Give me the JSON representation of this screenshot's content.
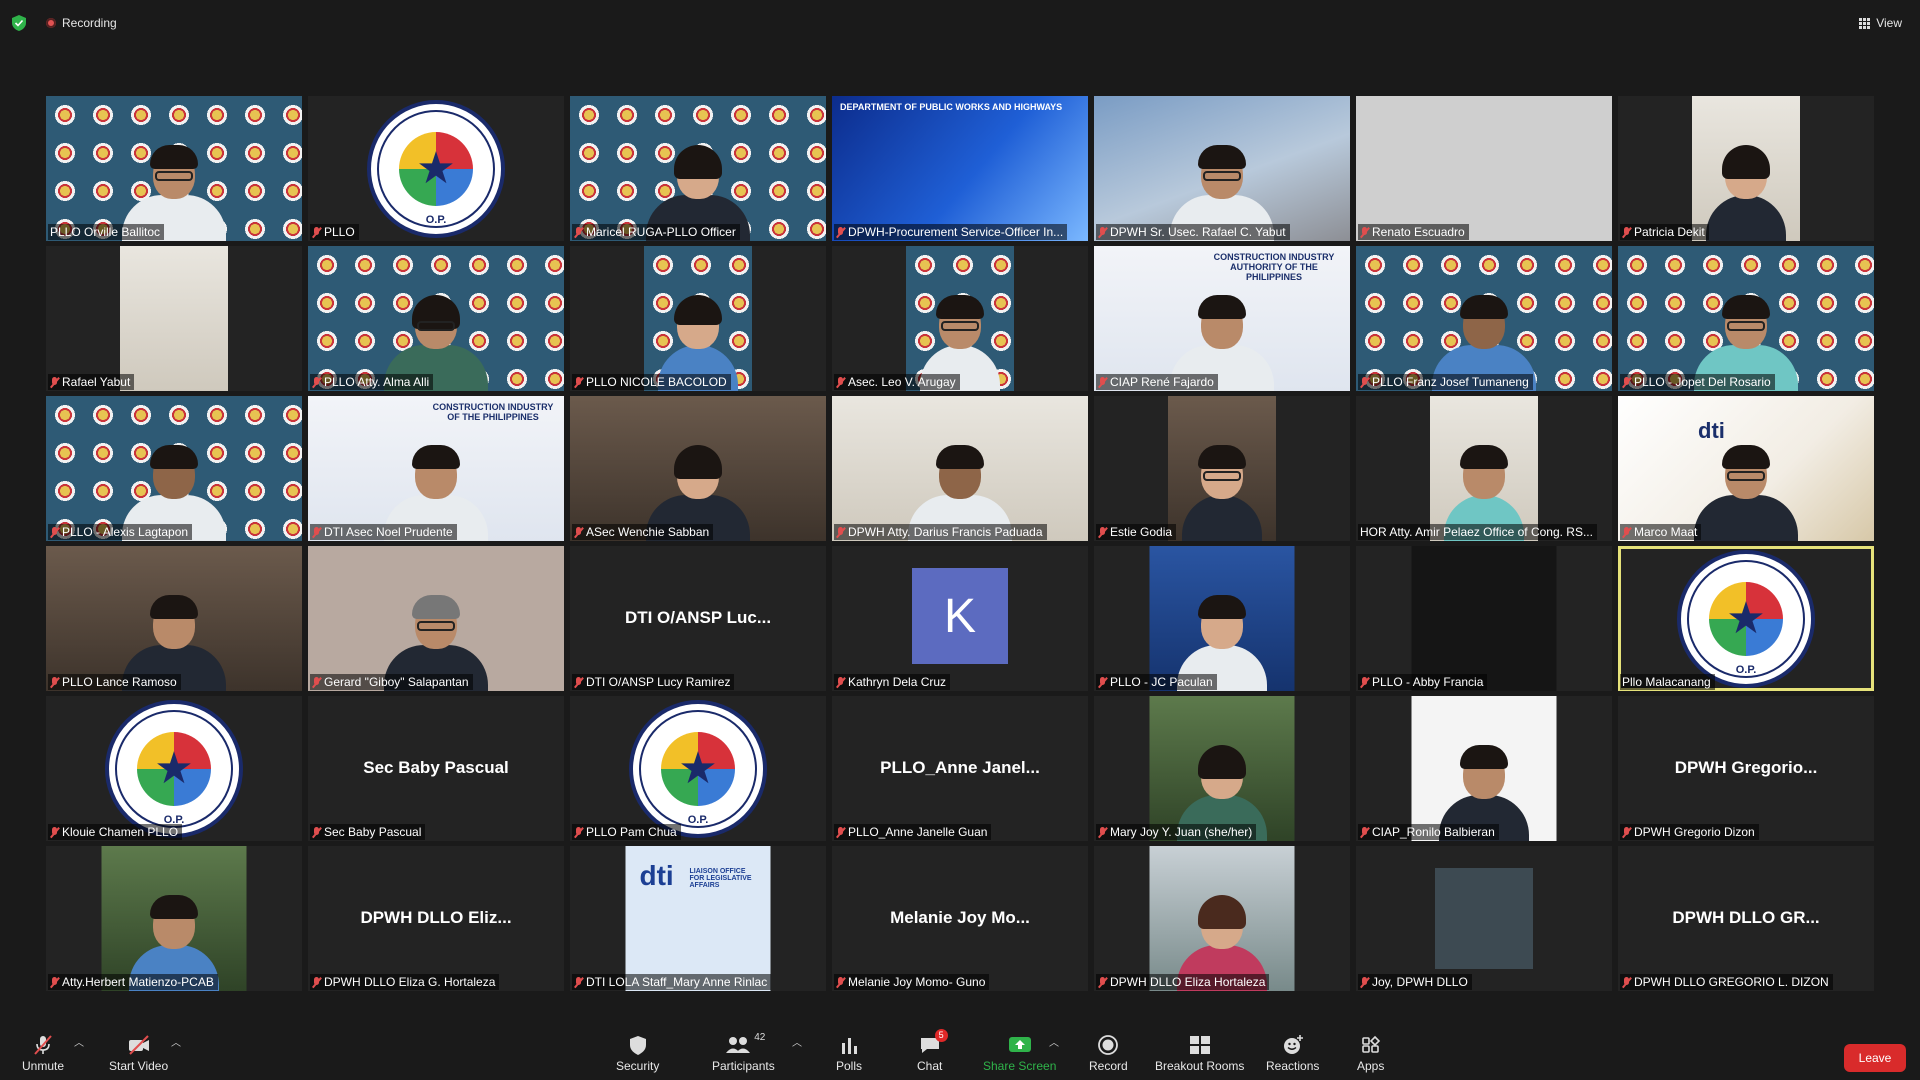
{
  "topbar": {
    "recording_label": "Recording",
    "view_label": "View"
  },
  "participants": [
    {
      "name": "PLLO Orville Ballitoc",
      "muted": false
    },
    {
      "name": "PLLO",
      "muted": true
    },
    {
      "name": "Maricel RUGA-PLLO Officer",
      "muted": true
    },
    {
      "name": "DPWH-Procurement Service-Officer In...",
      "muted": true,
      "banner": "DEPARTMENT OF PUBLIC WORKS AND HIGHWAYS"
    },
    {
      "name": "DPWH Sr. Usec. Rafael C. Yabut",
      "muted": true
    },
    {
      "name": "Renato Escuadro",
      "muted": true
    },
    {
      "name": "Patricia Dekit",
      "muted": true
    },
    {
      "name": "Rafael Yabut",
      "muted": true
    },
    {
      "name": "PLLO Atty. Alma Alli",
      "muted": true
    },
    {
      "name": "PLLO NICOLE BACOLOD",
      "muted": true
    },
    {
      "name": "Asec. Leo V. Arugay",
      "muted": true
    },
    {
      "name": "CIAP René Fajardo",
      "muted": true,
      "banner": "CONSTRUCTION INDUSTRY AUTHORITY OF THE PHILIPPINES"
    },
    {
      "name": "PLLO Franz Josef Tumaneng",
      "muted": true
    },
    {
      "name": "PLLO - Jopet Del Rosario",
      "muted": true
    },
    {
      "name": "PLLO - Alexis Lagtapon",
      "muted": true
    },
    {
      "name": "DTI Asec Noel Prudente",
      "muted": true,
      "banner": "CONSTRUCTION INDUSTRY OF THE PHILIPPINES"
    },
    {
      "name": "ASec Wenchie Sabban",
      "muted": true
    },
    {
      "name": "DPWH Atty. Darius Francis Paduada",
      "muted": true
    },
    {
      "name": "Estie Godia",
      "muted": true
    },
    {
      "name": "HOR Atty. Amir Pelaez Office of Cong. RS...",
      "muted": false
    },
    {
      "name": "Marco Maat",
      "muted": true
    },
    {
      "name": "PLLO Lance Ramoso",
      "muted": true
    },
    {
      "name": "Gerard \"Giboy\" Salapantan",
      "muted": true
    },
    {
      "name": "DTI O/ANSP Lucy Ramirez",
      "muted": true,
      "display": "DTI O/ANSP Luc..."
    },
    {
      "name": "Kathryn Dela Cruz",
      "muted": true,
      "initial": "K"
    },
    {
      "name": "PLLO - JC Paculan",
      "muted": true
    },
    {
      "name": "PLLO - Abby Francia",
      "muted": true
    },
    {
      "name": "Pllo Malacanang",
      "muted": false
    },
    {
      "name": "Klouie Chamen PLLO",
      "muted": true
    },
    {
      "name": "Sec Baby Pascual",
      "muted": true,
      "display": "Sec Baby Pascual"
    },
    {
      "name": "PLLO Pam Chua",
      "muted": true
    },
    {
      "name": "PLLO_Anne Janelle Guan",
      "muted": true,
      "display": "PLLO_Anne  Janel..."
    },
    {
      "name": "Mary Joy Y. Juan (she/her)",
      "muted": true
    },
    {
      "name": "CIAP_Ronilo Balbieran",
      "muted": true
    },
    {
      "name": "DPWH Gregorio Dizon",
      "muted": true,
      "display": "DPWH  Gregorio..."
    },
    {
      "name": "Atty.Herbert Matienzo-PCAB",
      "muted": true
    },
    {
      "name": "DPWH DLLO Eliza G. Hortaleza",
      "muted": true,
      "display": "DPWH  DLLO  Eliz..."
    },
    {
      "name": "DTI LOLA Staff_Mary Anne Rinlac",
      "muted": true
    },
    {
      "name": "Melanie Joy Momo- Guno",
      "muted": true,
      "display": "Melanie Joy Mo..."
    },
    {
      "name": "DPWH DLLO Eliza Hortaleza",
      "muted": true
    },
    {
      "name": "Joy, DPWH DLLO",
      "muted": true
    },
    {
      "name": "DPWH DLLO GREGORIO L. DIZON",
      "muted": true,
      "display": "DPWH  DLLO  GR..."
    }
  ],
  "logo": {
    "top_text": "PRESIDENTIAL LEGISLATIVE LIAISON OFFICE",
    "bottom_text": "O.P."
  },
  "dti_banner": {
    "brand": "dti",
    "subtitle": "LIAISON OFFICE FOR LEGISLATIVE AFFAIRS"
  },
  "toolbar": {
    "unmute": "Unmute",
    "start_video": "Start Video",
    "security": "Security",
    "participants": "Participants",
    "participants_count": "42",
    "polls": "Polls",
    "chat": "Chat",
    "chat_badge": "5",
    "share_screen": "Share Screen",
    "record": "Record",
    "breakout_rooms": "Breakout Rooms",
    "reactions": "Reactions",
    "apps": "Apps",
    "leave": "Leave"
  },
  "colors": {
    "background": "#1a1a1a",
    "tile": "#232323",
    "share_green": "#2fb34a",
    "leave_red": "#d92b2b",
    "active_speaker": "#e6e27a",
    "muted_red": "#e04e4e"
  }
}
